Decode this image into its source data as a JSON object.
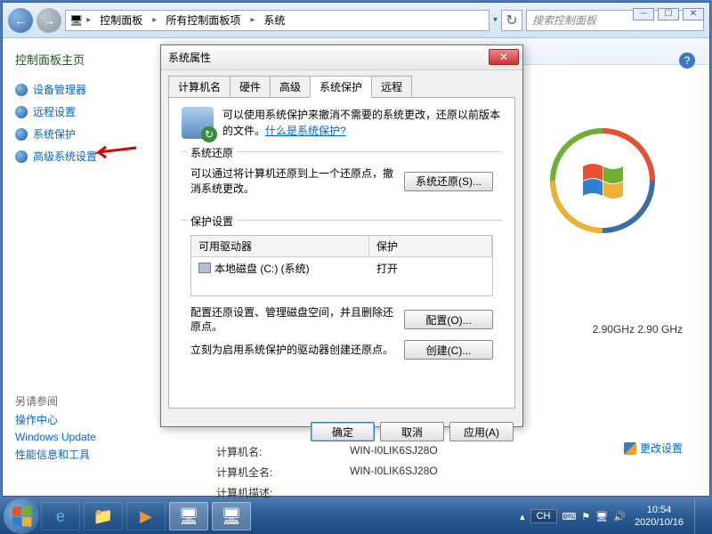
{
  "breadcrumb": {
    "seg1": "控制面板",
    "seg2": "所有控制面板项",
    "seg3": "系统"
  },
  "search": {
    "placeholder": "搜索控制面板"
  },
  "sidebar": {
    "header": "控制面板主页",
    "links": [
      "设备管理器",
      "远程设置",
      "系统保护",
      "高级系统设置"
    ],
    "seealso": "另请参阅",
    "extra": [
      "操作中心",
      "Windows Update",
      "性能信息和工具"
    ]
  },
  "dialog": {
    "title": "系统属性",
    "tabs": [
      "计算机名",
      "硬件",
      "高级",
      "系统保护",
      "远程"
    ],
    "intro": {
      "text": "可以使用系统保护来撤消不需要的系统更改，还原以前版本的文件。",
      "link": "什么是系统保护?"
    },
    "g1": {
      "title": "系统还原",
      "text": "可以通过将计算机还原到上一个还原点，撤消系统更改。",
      "btn": "系统还原(S)..."
    },
    "g2": {
      "title": "保护设置",
      "col1": "可用驱动器",
      "col2": "保护",
      "drive": "本地磁盘 (C:) (系统)",
      "status": "打开",
      "cfg_text": "配置还原设置、管理磁盘空间，并且删除还原点。",
      "cfg_btn": "配置(O)...",
      "create_text": "立刻为启用系统保护的驱动器创建还原点。",
      "create_btn": "创建(C)..."
    },
    "ok": "确定",
    "cancel": "取消",
    "apply": "应用(A)"
  },
  "main": {
    "name_lbl": "计算机名:",
    "name_val": "WIN-I0LIK6SJ28O",
    "full_lbl": "计算机全名:",
    "full_val": "WIN-I0LIK6SJ28O",
    "desc_lbl": "计算机描述:",
    "change": "更改设置",
    "cpu": "2.90GHz  2.90 GHz"
  },
  "tray": {
    "ime": "CH",
    "time": "10:54",
    "date": "2020/10/16"
  }
}
